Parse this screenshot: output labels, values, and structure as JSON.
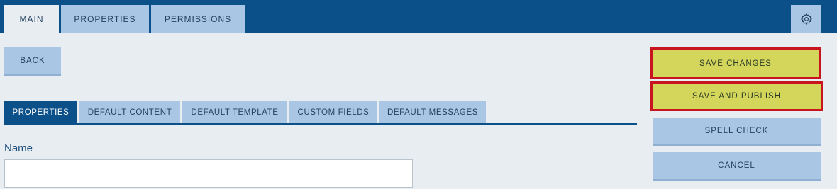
{
  "top_tabs": [
    {
      "label": "MAIN",
      "active": true
    },
    {
      "label": "PROPERTIES",
      "active": false
    },
    {
      "label": "PERMISSIONS",
      "active": false
    }
  ],
  "settings_icon": "gear-icon",
  "back_label": "BACK",
  "sub_tabs": [
    {
      "label": "PROPERTIES",
      "active": true
    },
    {
      "label": "DEFAULT CONTENT",
      "active": false
    },
    {
      "label": "DEFAULT TEMPLATE",
      "active": false
    },
    {
      "label": "CUSTOM FIELDS",
      "active": false
    },
    {
      "label": "DEFAULT MESSAGES",
      "active": false
    }
  ],
  "form": {
    "name_label": "Name",
    "name_value": ""
  },
  "actions": {
    "save_changes": "SAVE CHANGES",
    "save_and_publish": "SAVE AND PUBLISH",
    "spell_check": "SPELL CHECK",
    "cancel": "CANCEL"
  },
  "colors": {
    "primary": "#0b5089",
    "tab_inactive": "#a9c6e4",
    "highlight_fill": "#d3d65a",
    "highlight_border": "#c8141e"
  }
}
